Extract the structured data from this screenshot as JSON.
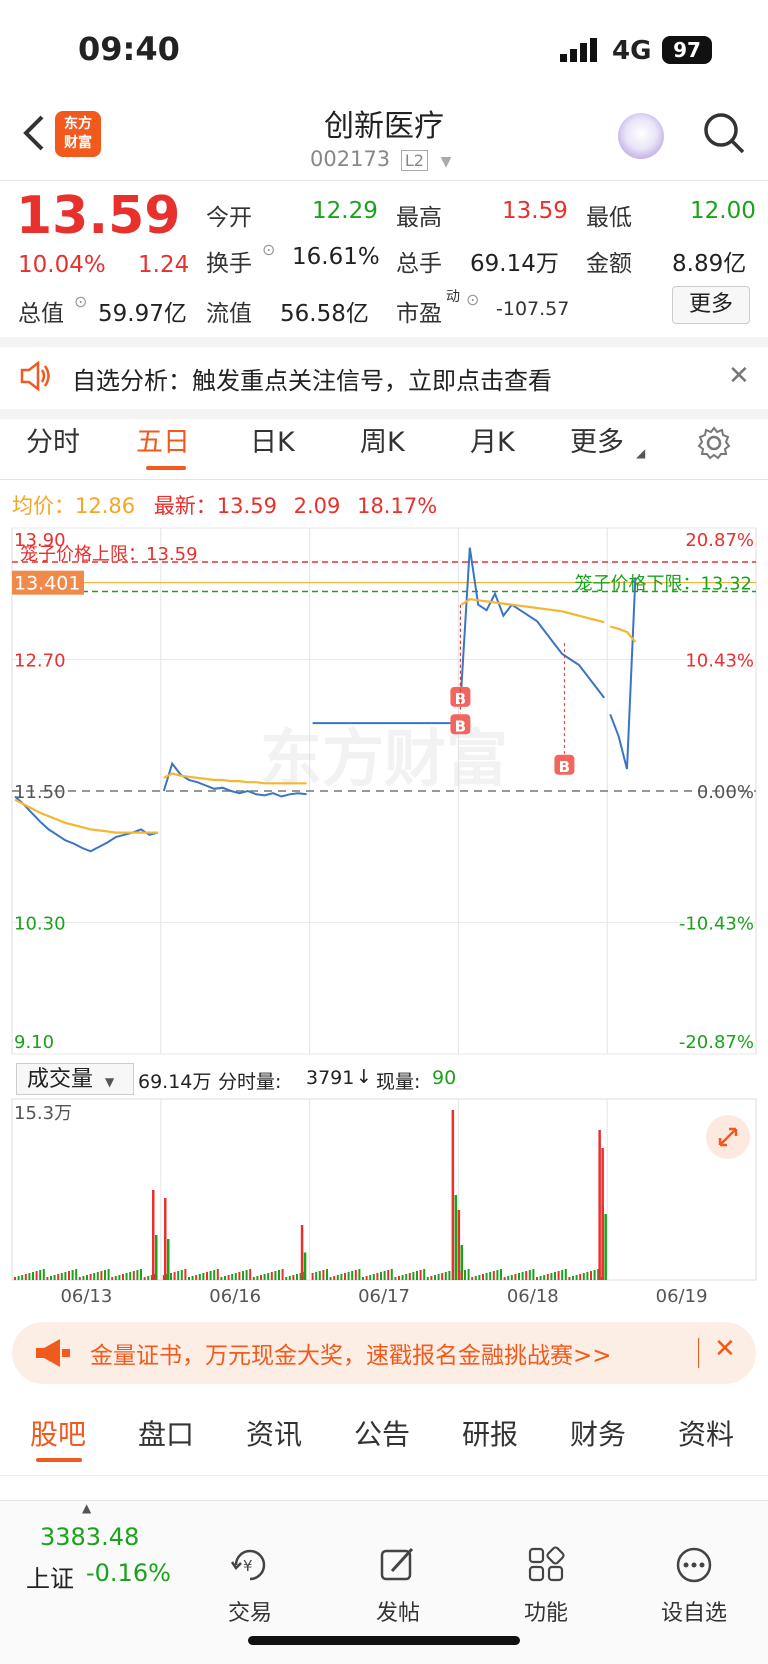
{
  "status_bar": {
    "time": "09:40",
    "network": "4G",
    "battery": "97"
  },
  "header": {
    "title": "创新医疗",
    "code": "002173",
    "level": "L2",
    "logo_line1": "东方",
    "logo_line2": "财富"
  },
  "quote": {
    "price": "13.59",
    "pct": "10.04%",
    "chg": "1.24",
    "open_label": "今开",
    "open": "12.29",
    "high_label": "最高",
    "high": "13.59",
    "low_label": "最低",
    "low": "12.00",
    "turnover_label": "换手",
    "turnover": "16.61%",
    "vol_label": "总手",
    "vol": "69.14万",
    "amount_label": "金额",
    "amount": "8.89亿",
    "mcap_label": "总值",
    "mcap": "59.97亿",
    "float_label": "流值",
    "float": "56.58亿",
    "pe_label": "市盈",
    "pe_sup": "动",
    "pe": "-107.57",
    "more": "更多"
  },
  "notice": {
    "text": "自选分析：触发重点关注信号，立即点击查看"
  },
  "tabs": [
    "分时",
    "五日",
    "日K",
    "周K",
    "月K",
    "更多"
  ],
  "active_tab": "五日",
  "chart_info": {
    "avg_label": "均价：",
    "avg": "12.86",
    "latest_label": "最新：",
    "latest": "13.59",
    "chg": "2.09",
    "pct": "18.17%"
  },
  "chart_data": {
    "type": "line",
    "y_left_ticks": [
      "13.90",
      "12.70",
      "11.50",
      "10.30",
      "9.10"
    ],
    "y_right_ticks": [
      "20.87%",
      "10.43%",
      "0.00%",
      "-10.43%",
      "-20.87%"
    ],
    "ylim": [
      9.1,
      13.9
    ],
    "prev_close": 11.5,
    "upper_limit_label": "笼子价格上限：13.59",
    "lower_limit_label": "笼子价格下限：13.32",
    "cursor_price": "13.401",
    "x_labels": [
      "06/13",
      "06/16",
      "06/17",
      "06/18",
      "06/19"
    ],
    "buy_marker": "B",
    "series": [
      {
        "name": "price",
        "color": "#3a74c4",
        "values": [
          11.45,
          11.38,
          11.3,
          11.22,
          11.15,
          11.1,
          11.05,
          11.02,
          10.98,
          10.95,
          10.99,
          11.03,
          11.08,
          11.1,
          11.12,
          11.15,
          11.1,
          11.12,
          11.5,
          11.75,
          11.65,
          11.6,
          11.58,
          11.55,
          11.52,
          11.53,
          11.5,
          11.48,
          11.5,
          11.47,
          11.46,
          11.48,
          11.45,
          11.47,
          11.48,
          11.47,
          12.12,
          12.12,
          12.12,
          12.12,
          12.12,
          12.12,
          12.12,
          12.12,
          12.12,
          12.12,
          12.12,
          12.12,
          12.12,
          12.12,
          12.12,
          12.12,
          12.12,
          12.12,
          12.45,
          13.72,
          13.2,
          13.15,
          13.3,
          13.1,
          13.2,
          13.15,
          13.1,
          13.05,
          12.95,
          12.85,
          12.75,
          12.7,
          12.65,
          12.55,
          12.45,
          12.35,
          12.2,
          12.0,
          11.7,
          13.45
        ]
      },
      {
        "name": "avg",
        "color": "#f5b731",
        "values": [
          11.42,
          11.38,
          11.34,
          11.3,
          11.27,
          11.24,
          11.21,
          11.19,
          11.17,
          11.15,
          11.14,
          11.13,
          11.12,
          11.12,
          11.12,
          11.12,
          11.12,
          11.12,
          11.62,
          11.66,
          11.64,
          11.63,
          11.62,
          11.61,
          11.6,
          11.6,
          11.59,
          11.59,
          11.58,
          11.58,
          11.57,
          11.57,
          11.57,
          11.57,
          11.57,
          11.57,
          null,
          null,
          null,
          null,
          null,
          null,
          null,
          null,
          null,
          null,
          null,
          null,
          null,
          null,
          null,
          null,
          null,
          null,
          13.2,
          13.25,
          13.24,
          13.23,
          13.22,
          13.21,
          13.2,
          13.19,
          13.18,
          13.17,
          13.16,
          13.15,
          13.14,
          13.12,
          13.1,
          13.08,
          13.06,
          13.04,
          13.0,
          12.98,
          12.95,
          12.86
        ]
      }
    ]
  },
  "volume": {
    "selector": "成交量",
    "total": "69.14万",
    "fs_label": "分时量:",
    "fs_value": "3791",
    "now_label": "现量:",
    "now_value": "90",
    "max_label": "15.3万"
  },
  "ad": {
    "text": "金量证书，万元现金大奖，速戳报名金融挑战赛>>"
  },
  "bottom_tabs": [
    "股吧",
    "盘口",
    "资讯",
    "公告",
    "研报",
    "财务",
    "资料"
  ],
  "active_bottom_tab": "股吧",
  "index": {
    "value": "3383.48",
    "name": "上证",
    "pct": "-0.16%"
  },
  "nav": [
    "交易",
    "发帖",
    "功能",
    "设自选"
  ]
}
